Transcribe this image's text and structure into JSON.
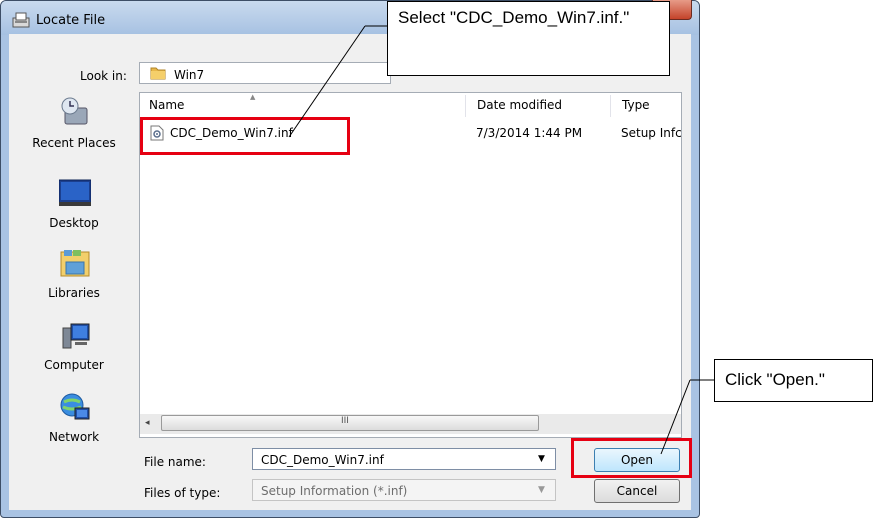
{
  "window": {
    "title": "Locate File",
    "colors": {
      "frame": "#a9c3e3",
      "client": "#f0f0f0",
      "highlight": "#e60012"
    }
  },
  "lookin": {
    "label": "Look in:",
    "value": "Win7",
    "icon": "folder-icon"
  },
  "places": [
    {
      "label": "Recent Places",
      "icon": "recent-places-icon"
    },
    {
      "label": "Desktop",
      "icon": "desktop-icon"
    },
    {
      "label": "Libraries",
      "icon": "libraries-icon"
    },
    {
      "label": "Computer",
      "icon": "computer-icon"
    },
    {
      "label": "Network",
      "icon": "network-icon"
    }
  ],
  "filelist": {
    "columns": [
      "Name",
      "Date modified",
      "Type"
    ],
    "rows": [
      {
        "name": "CDC_Demo_Win7.inf",
        "date": "7/3/2014 1:44 PM",
        "type": "Setup Infc",
        "icon": "setup-file-icon"
      }
    ]
  },
  "scrollbar": {
    "grip": "III",
    "left_arrow": "◂"
  },
  "form": {
    "filename_label": "File name:",
    "filename_value": "CDC_Demo_Win7.inf",
    "filetype_label": "Files of type:",
    "filetype_value": "Setup Information (*.inf)",
    "open_label": "Open",
    "cancel_label": "Cancel"
  },
  "annotations": {
    "select_callout": "Select \"CDC_Demo_Win7.inf.\"",
    "open_callout": "Click \"Open.\""
  }
}
